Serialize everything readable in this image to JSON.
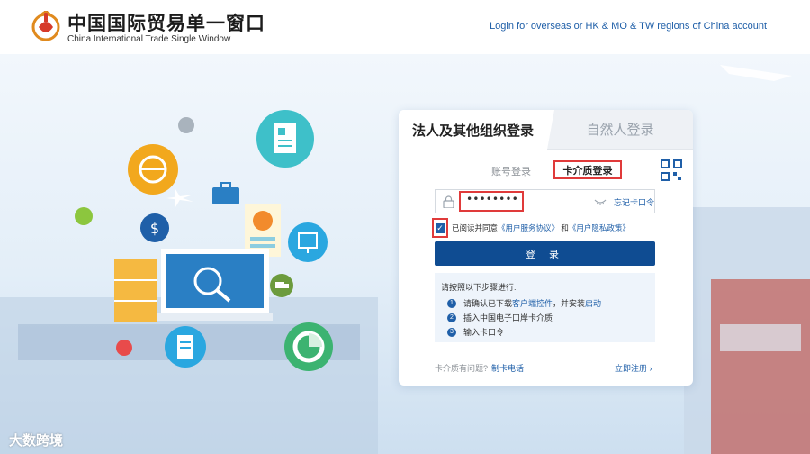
{
  "header": {
    "brand_cn": "中国国际贸易单一窗口",
    "brand_en": "China International Trade Single Window",
    "overseas_link": "Login for overseas or HK & MO & TW regions of China account"
  },
  "login": {
    "tabs": [
      {
        "label": "法人及其他组织登录",
        "active": true
      },
      {
        "label": "自然人登录",
        "active": false
      }
    ],
    "methods": {
      "account": "账号登录",
      "card": "卡介质登录"
    },
    "password_value": "••••••••",
    "forgot_label": "忘记卡口令",
    "agree": {
      "prefix": "已阅读并同意",
      "service_agreement": "《用户服务协议》",
      "and": "和",
      "privacy_policy": "《用户隐私政策》",
      "checked": true
    },
    "submit_label": "登 录",
    "steps": {
      "title": "请按照以下步骤进行:",
      "items": [
        {
          "num": "1",
          "pre": "请确认已下载",
          "link": "客户端控件",
          "mid": "，并安装",
          "link2": "启动"
        },
        {
          "num": "2",
          "text": "插入中国电子口岸卡介质"
        },
        {
          "num": "3",
          "text": "输入卡口令"
        }
      ]
    },
    "footer": {
      "problem": "卡介质有问题?",
      "problem_link": "制卡电话",
      "register": "立即注册 ›"
    }
  },
  "watermark": "大数跨境",
  "colors": {
    "accent": "#0f4c92",
    "link": "#1f5fa8",
    "highlight": "#e03a3a"
  }
}
